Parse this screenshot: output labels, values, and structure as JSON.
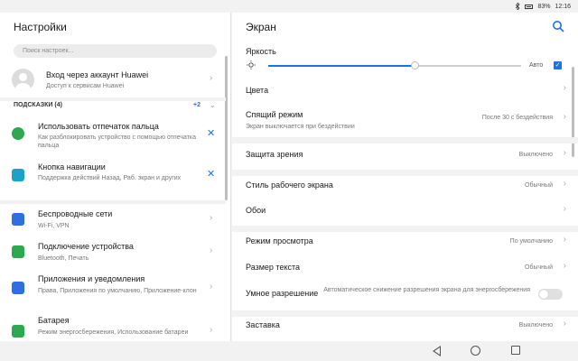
{
  "status": {
    "battery": "83%",
    "time": "12:16"
  },
  "left": {
    "title": "Настройки",
    "search_placeholder": "Поиск настроек...",
    "account": {
      "title": "Вход через аккаунт Huawei",
      "subtitle": "Доступ к сервисам Huawei"
    },
    "suggestions": {
      "label": "ПОДСКАЗКИ (4)",
      "more": "+2"
    },
    "suggestion_items": [
      {
        "title": "Использовать отпечаток пальца",
        "subtitle": "Как разблокировать устройство с помощью отпечатка пальца",
        "icon": "fingerprint-icon",
        "color": "#2fa84f"
      },
      {
        "title": "Кнопка навигации",
        "subtitle": "Поддержка действий Назад, Раб. экран и других",
        "icon": "navigation-dot-icon",
        "color": "#1aa3c8"
      }
    ],
    "items": [
      {
        "title": "Беспроводные сети",
        "subtitle": "Wi-Fi, VPN",
        "icon": "wifi-icon",
        "color": "#2f6fe0"
      },
      {
        "title": "Подключение устройства",
        "subtitle": "Bluetooth, Печать",
        "icon": "device-link-icon",
        "color": "#2fa84f"
      },
      {
        "title": "Приложения и уведомления",
        "subtitle": "Права, Приложения по умолчанию, Приложение-клон",
        "icon": "apps-icon",
        "color": "#2f6fe0"
      },
      {
        "title": "Батарея",
        "subtitle": "Режим энергосбережения, Использование батареи",
        "icon": "battery-icon",
        "color": "#2fa84f"
      }
    ]
  },
  "right": {
    "title": "Экран",
    "brightness": {
      "label": "Яркость",
      "auto_label": "Авто",
      "level": 0.58
    },
    "rows": [
      {
        "title": "Цвета",
        "subtitle": "",
        "value": ""
      },
      {
        "title": "Спящий режим",
        "subtitle": "Экран выключается при бездействии",
        "value": "После 30 с бездействия"
      },
      {
        "title": "Защита зрения",
        "subtitle": "",
        "value": "Выключено"
      },
      {
        "title": "Стиль рабочего экрана",
        "subtitle": "",
        "value": "Обычный"
      },
      {
        "title": "Обои",
        "subtitle": "",
        "value": ""
      },
      {
        "title": "Режим просмотра",
        "subtitle": "",
        "value": "По умолчанию"
      },
      {
        "title": "Размер текста",
        "subtitle": "",
        "value": "Обычный"
      },
      {
        "title": "Умное разрешение",
        "subtitle": "",
        "value": "Автоматическое снижение разрешения экрана для энергосбережения"
      },
      {
        "title": "Заставка",
        "subtitle": "",
        "value": "Выключено"
      }
    ]
  }
}
